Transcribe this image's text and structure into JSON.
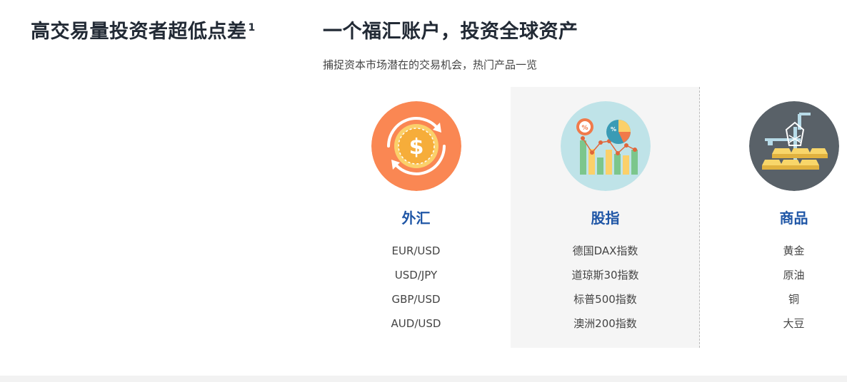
{
  "left": {
    "title": "高交易量投资者超低点差",
    "title_sup": "1"
  },
  "main": {
    "title": "一个福汇账户，投资全球资产",
    "subtitle": "捕捉资本市场潜在的交易机会，热门产品一览"
  },
  "columns": [
    {
      "title": "外汇",
      "icon": "forex-dollar-icon",
      "items": [
        "EUR/USD",
        "USD/JPY",
        "GBP/USD",
        "AUD/USD"
      ]
    },
    {
      "title": "股指",
      "icon": "stock-chart-icon",
      "items": [
        "德国DAX指数",
        "道琼斯30指数",
        "标普500指数",
        "澳洲200指数"
      ]
    },
    {
      "title": "商品",
      "icon": "gold-bars-oil-icon",
      "items": [
        "黄金",
        "原油",
        "铜",
        "大豆"
      ]
    }
  ],
  "colors": {
    "heading": "#222a35",
    "accent_blue": "#1f56a6",
    "forex_bg": "#fa8753",
    "index_bg": "#bfe3e8",
    "commodity_bg": "#596168",
    "highlight_col_bg": "#f5f5f5"
  }
}
